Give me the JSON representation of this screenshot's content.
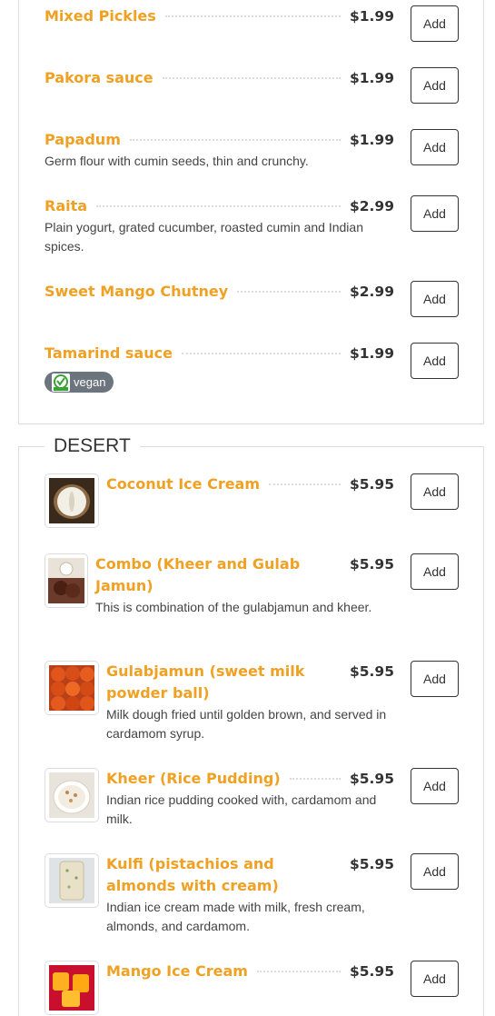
{
  "add_label": "Add",
  "sections": {
    "condiments": {
      "items": [
        {
          "name": "Mixed Pickles",
          "price": "$1.99"
        },
        {
          "name": "Pakora sauce",
          "price": "$1.99"
        },
        {
          "name": "Papadum",
          "price": "$1.99",
          "description": "Germ flour with cumin seeds, thin and crunchy."
        },
        {
          "name": "Raita",
          "price": "$2.99",
          "description": "Plain yogurt, grated cucumber, roasted cumin and Indian spices."
        },
        {
          "name": "Sweet Mango Chutney",
          "price": "$2.99"
        },
        {
          "name": "Tamarind sauce",
          "price": "$1.99",
          "badge": "vegan",
          "badge_icon": "vegan-icon"
        }
      ]
    },
    "desert": {
      "title": "DESERT",
      "items": [
        {
          "name": "Coconut Ice Cream",
          "price": "$5.95",
          "image": "coconut-ice-cream-photo"
        },
        {
          "name": "Combo (Kheer and Gulab Jamun)",
          "price": "$5.95",
          "description": "This is combination of the gulabjamun and kheer.",
          "image": "combo-photo"
        },
        {
          "name": "Gulabjamun (sweet milk powder ball)",
          "price": "$5.95",
          "description": "Milk dough fried until golden brown, and served in cardamom syrup.",
          "image": "gulabjamun-photo"
        },
        {
          "name": "Kheer (Rice Pudding)",
          "price": "$5.95",
          "description": "Indian rice pudding cooked with, cardamom and milk.",
          "image": "kheer-photo"
        },
        {
          "name": "Kulfi (pistachios and almonds with cream)",
          "price": "$5.95",
          "description": "Indian ice cream made with milk, fresh cream, almonds, and cardamom.",
          "image": "kulfi-photo"
        },
        {
          "name": "Mango Ice Cream",
          "price": "$5.95",
          "image": "mango-ice-cream-photo"
        }
      ]
    }
  },
  "colors": {
    "item_name": "#f0a022",
    "badge_bg": "#6c757d",
    "vegan_green": "#3aa335"
  }
}
